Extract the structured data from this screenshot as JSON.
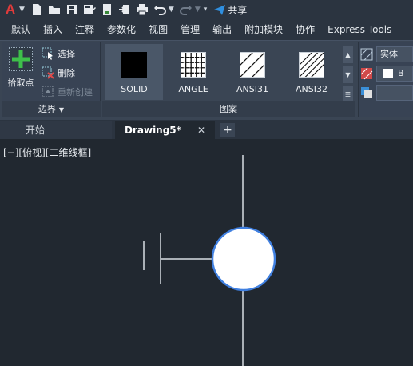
{
  "app": {
    "logo_letter": "A",
    "share_label": "共享"
  },
  "ribbon_tabs": [
    "默认",
    "插入",
    "注释",
    "参数化",
    "视图",
    "管理",
    "输出",
    "附加模块",
    "协作",
    "Express Tools"
  ],
  "boundary_panel": {
    "pick_points_label": "拾取点",
    "select_label": "选择",
    "delete_label": "删除",
    "recreate_label": "重新创建",
    "title": "边界"
  },
  "pattern_panel": {
    "title": "图案",
    "patterns": [
      {
        "name": "SOLID",
        "selected": true
      },
      {
        "name": "ANGLE",
        "selected": false
      },
      {
        "name": "ANSI31",
        "selected": false
      },
      {
        "name": "ANSI32",
        "selected": false
      }
    ]
  },
  "properties_panel": {
    "type_value": "实体",
    "color_value": "B"
  },
  "file_tabs": {
    "start_label": "开始",
    "drawing_label": "Drawing5*",
    "close_glyph": "✕",
    "add_glyph": "+"
  },
  "viewport": {
    "label": "[−][俯视][二维线框]"
  },
  "colors": {
    "accent_blue": "#2f8fe0",
    "logo_red": "#e03b3b",
    "circle_outline": "#3f7fe0",
    "canvas_bg": "#212830"
  }
}
